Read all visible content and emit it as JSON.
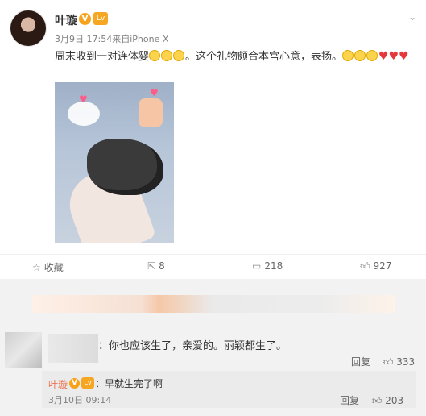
{
  "post": {
    "author": "叶璇",
    "verified_badge": "V",
    "level_badge": "Lv",
    "more_icon": "chevron-down-icon",
    "date": "3月9日 17:54",
    "source_prefix": "来自",
    "source": "iPhone X",
    "text_part1": "周末收到一对连体婴",
    "text_part2": "。这个礼物颇合本宫心意，表扬。",
    "hearts": "♥♥♥",
    "actions": {
      "favorite_label": "收藏",
      "repost_count": "8",
      "comment_count": "218",
      "like_count": "927"
    }
  },
  "comment": {
    "text": "：你也应该生了，亲爱的。丽颖都生了。",
    "reply_label": "回复",
    "like_count": "333"
  },
  "reply": {
    "author": "叶璇",
    "text": "：早就生完了啊",
    "time": "3月10日 09:14",
    "reply_label": "回复",
    "like_count": "203"
  },
  "colors": {
    "accent": "#eb7350",
    "badge": "#f7a21b",
    "heart": "#e5383b"
  }
}
